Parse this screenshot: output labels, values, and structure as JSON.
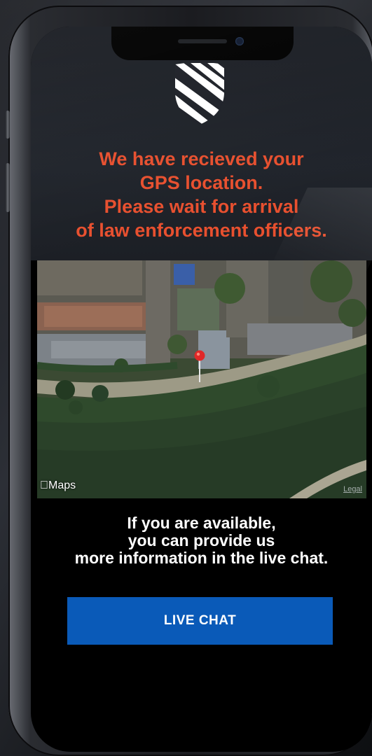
{
  "header": {
    "logo_icon": "striped-shield-icon",
    "headline": "We have recieved your\nGPS location.\nPlease wait for arrival\nof law enforcement officers."
  },
  "map": {
    "attribution": "Maps",
    "attribution_icon": "apple-logo-icon",
    "legal": "Legal",
    "marker_icon": "map-pin-icon"
  },
  "info": {
    "text": "If you are available,\nyou can provide us\nmore information in the live chat."
  },
  "actions": {
    "live_chat_label": "LIVE CHAT"
  },
  "colors": {
    "headline": "#e8502f",
    "button": "#0a5ab8",
    "info_text": "#ffffff"
  }
}
